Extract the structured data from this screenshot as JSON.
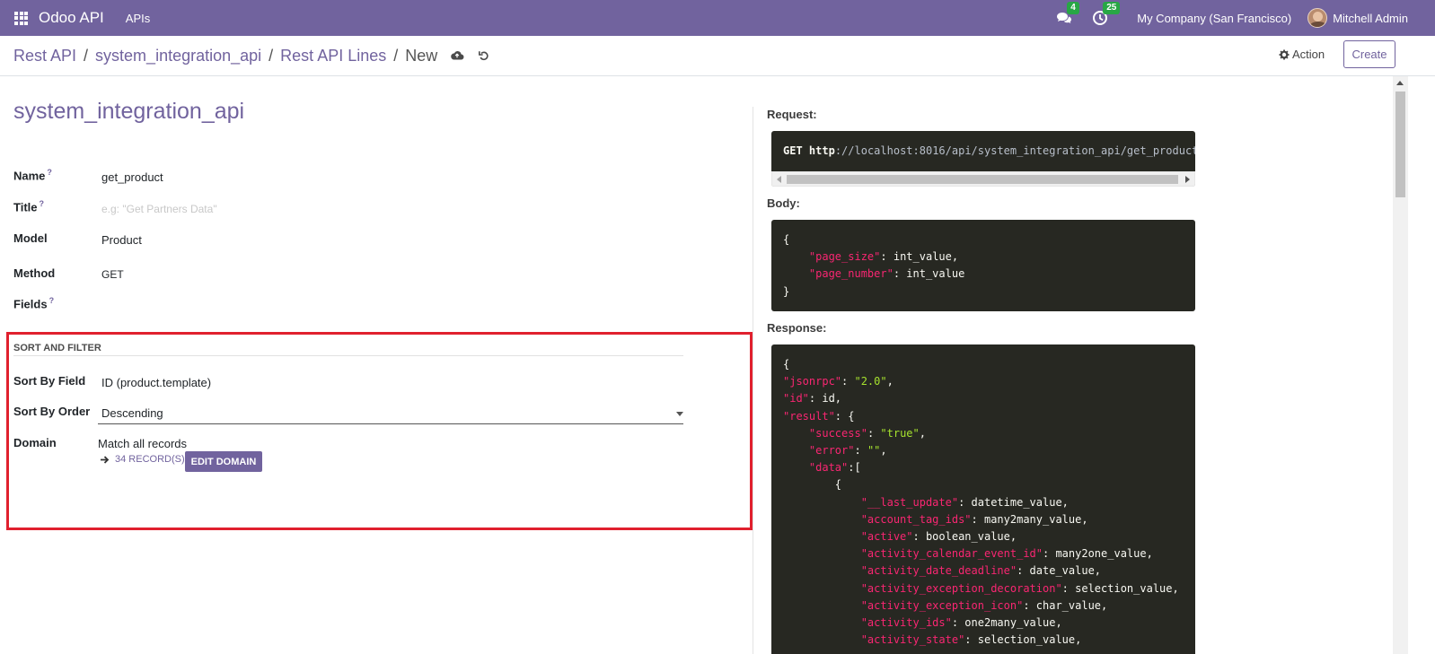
{
  "navbar": {
    "brand": "Odoo API",
    "menu_apis": "APIs",
    "chat_badge": "4",
    "activity_badge": "25",
    "company": "My Company (San Francisco)",
    "user": "Mitchell Admin"
  },
  "breadcrumb": {
    "items": [
      "Rest API",
      "system_integration_api",
      "Rest API Lines"
    ],
    "current": "New",
    "separator": "/"
  },
  "control": {
    "action_label": "Action",
    "create_label": "Create"
  },
  "form": {
    "title": "system_integration_api",
    "help_mark": "?",
    "fields": {
      "name_label": "Name",
      "name_value": "get_product",
      "title_label": "Title",
      "title_placeholder": "e.g: \"Get Partners Data\"",
      "model_label": "Model",
      "model_value": "Product",
      "method_label": "Method",
      "method_value": "GET",
      "fields_label": "Fields"
    },
    "sort_filter": {
      "section_title": "SORT AND FILTER",
      "sort_field_label": "Sort By Field",
      "sort_field_value": "ID (product.template)",
      "sort_order_label": "Sort By Order",
      "sort_order_value": "Descending",
      "domain_label": "Domain",
      "domain_match": "Match",
      "domain_all": "all records",
      "records_link": "34 RECORD(S)",
      "edit_domain": "EDIT DOMAIN"
    }
  },
  "api_panel": {
    "request_label": "Request:",
    "request_method": "GET",
    "request_scheme": "http",
    "request_url": "://localhost:8016/api/system_integration_api/get_product",
    "body_label": "Body:",
    "body_lines": [
      {
        "t": "{"
      },
      {
        "indent": "    ",
        "key": "\"page_size\"",
        "rest": ": int_value,"
      },
      {
        "indent": "    ",
        "key": "\"page_number\"",
        "rest": ": int_value"
      },
      {
        "t": "}"
      }
    ],
    "response_label": "Response:",
    "response_lines": [
      {
        "t": "{"
      },
      {
        "indent": "",
        "key": "\"jsonrpc\"",
        "rest": ": ",
        "str": "\"2.0\"",
        "end": ","
      },
      {
        "indent": "",
        "key": "\"id\"",
        "rest": ": id,"
      },
      {
        "indent": "",
        "key": "\"result\"",
        "rest": ": {"
      },
      {
        "indent": "    ",
        "key": "\"success\"",
        "rest": ": ",
        "str": "\"true\"",
        "end": ","
      },
      {
        "indent": "    ",
        "key": "\"error\"",
        "rest": ": ",
        "str": "\"\"",
        "end": ","
      },
      {
        "indent": "    ",
        "key": "\"data\"",
        "rest": ":["
      },
      {
        "t": "        {"
      },
      {
        "indent": "            ",
        "key": "\"__last_update\"",
        "rest": ": datetime_value,"
      },
      {
        "indent": "            ",
        "key": "\"account_tag_ids\"",
        "rest": ": many2many_value,"
      },
      {
        "indent": "            ",
        "key": "\"active\"",
        "rest": ": boolean_value,"
      },
      {
        "indent": "            ",
        "key": "\"activity_calendar_event_id\"",
        "rest": ": many2one_value,"
      },
      {
        "indent": "            ",
        "key": "\"activity_date_deadline\"",
        "rest": ": date_value,"
      },
      {
        "indent": "            ",
        "key": "\"activity_exception_decoration\"",
        "rest": ": selection_value,"
      },
      {
        "indent": "            ",
        "key": "\"activity_exception_icon\"",
        "rest": ": char_value,"
      },
      {
        "indent": "            ",
        "key": "\"activity_ids\"",
        "rest": ": one2many_value,"
      },
      {
        "indent": "            ",
        "key": "\"activity_state\"",
        "rest": ": selection_value,"
      }
    ]
  },
  "colors": {
    "brand": "#71639e",
    "highlight_border": "#e0202e",
    "code_bg": "#272822",
    "code_key": "#f92672",
    "code_string": "#a6e22e"
  }
}
